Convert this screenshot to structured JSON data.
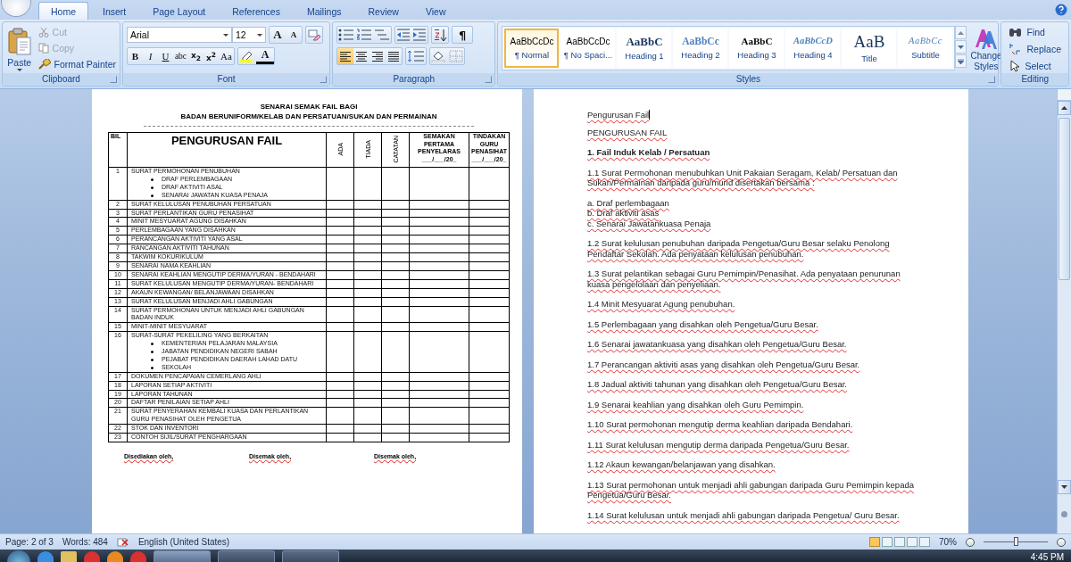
{
  "tabs": [
    {
      "label": "Home",
      "selected": true
    },
    {
      "label": "Insert",
      "selected": false
    },
    {
      "label": "Page Layout",
      "selected": false
    },
    {
      "label": "References",
      "selected": false
    },
    {
      "label": "Mailings",
      "selected": false
    },
    {
      "label": "Review",
      "selected": false
    },
    {
      "label": "View",
      "selected": false
    }
  ],
  "ribbon": {
    "clipboard": {
      "label": "Clipboard",
      "paste": "Paste",
      "items": [
        {
          "kind": "cut",
          "label": "Cut",
          "disabled": true
        },
        {
          "kind": "copy",
          "label": "Copy",
          "disabled": true
        },
        {
          "kind": "painter",
          "label": "Format Painter",
          "disabled": false
        }
      ]
    },
    "font": {
      "label": "Font",
      "font_name": "Arial",
      "font_size": "12",
      "grow": "A",
      "shrink": "A",
      "format_buttons": [
        {
          "kind": "bold",
          "label": "B"
        },
        {
          "kind": "italic",
          "label": "I"
        },
        {
          "kind": "underline",
          "label": "U"
        },
        {
          "kind": "strike",
          "label": "abc"
        },
        {
          "kind": "sub",
          "label": "x$_{2}$"
        },
        {
          "kind": "sup",
          "label": "x$^{2}$"
        },
        {
          "kind": "case",
          "label": "Aa"
        }
      ],
      "font_color": "A"
    },
    "paragraph": {
      "label": "Paragraph",
      "pilcrow": "¶",
      "alignment": [
        {
          "kind": "left",
          "selected": true
        },
        {
          "kind": "center",
          "selected": false
        },
        {
          "kind": "right",
          "selected": false
        },
        {
          "kind": "justify",
          "selected": false
        }
      ]
    },
    "styles": {
      "label": "Styles",
      "items": [
        {
          "kind": "normal",
          "preview": "AaBbCcDc",
          "name": "¶ Normal",
          "selected": true
        },
        {
          "kind": "normal",
          "preview": "AaBbCcDc",
          "name": "¶ No Spaci...",
          "selected": false
        },
        {
          "kind": "heading1",
          "preview": "AaBbC",
          "name": "Heading 1",
          "selected": false
        },
        {
          "kind": "heading2",
          "preview": "AaBbCc",
          "name": "Heading 2",
          "selected": false
        },
        {
          "kind": "heading3",
          "preview": "AaBbC",
          "name": "Heading 3",
          "selected": false
        },
        {
          "kind": "heading4",
          "preview": "AaBbCcD",
          "name": "Heading 4",
          "selected": false
        },
        {
          "kind": "title",
          "preview": "AaB",
          "name": "Title",
          "selected": false
        },
        {
          "kind": "subtitle",
          "preview": "AaBbCc",
          "name": "Subtitle",
          "selected": false
        }
      ],
      "change_styles": "Change Styles"
    },
    "editing": {
      "label": "Editing",
      "items": [
        {
          "kind": "find",
          "label": "Find"
        },
        {
          "kind": "replace",
          "label": "Replace"
        },
        {
          "kind": "select",
          "label": "Select"
        }
      ]
    }
  },
  "left_page": {
    "title_lines": [
      "SENARAI SEMAK FAIL BAGI",
      "BADAN BERUNIFORM/KELAB DAN PERSATUAN/SUKAN DAN PERMAINAN"
    ],
    "table": {
      "columns": [
        {
          "kind": "small",
          "label": "BIL"
        },
        {
          "kind": "big",
          "label": "PENGURUSAN FAIL"
        },
        {
          "kind": "vertical",
          "label": "ADA"
        },
        {
          "kind": "vertical",
          "label": "TIADA"
        },
        {
          "kind": "vertical",
          "label": "CATATAN"
        },
        {
          "kind": "small",
          "label": "SEMAKAN PERTAMA PENYELARAS ___/___/20_"
        },
        {
          "kind": "small",
          "label": "TINDAKAN GURU PENASIHAT ___/___/20_"
        }
      ],
      "rows": [
        {
          "no": "1",
          "text": "SURAT PERMOHONAN  PENUBUHAN",
          "bullets": [
            "DRAF PERLEMBAGAAN",
            "DRAF AKTIVITI ASAL",
            "SENARAI JAWATAN KUASA PENAJA"
          ]
        },
        {
          "no": "2",
          "text": "SURAT KELULUSAN  PENUBUHAN  PERSATUAN"
        },
        {
          "no": "3",
          "text": "SURAT PERLANTIKAN  GURU PENASIHAT"
        },
        {
          "no": "4",
          "text": "MINIT MESYUARAT AGUNG  DISAHKAN"
        },
        {
          "no": "5",
          "text": "PERLEMBAGAAN YANG DISAHKAN"
        },
        {
          "no": "6",
          "text": "PERANCANGAN AKTIVITI YANG ASAL"
        },
        {
          "no": "7",
          "text": "RANCANGAN AKTIVITI TAHUNAN"
        },
        {
          "no": "8",
          "text": "TAKWIM KOKURIKULUM"
        },
        {
          "no": "9",
          "text": "SENARAI NAMA KEAHLIAN"
        },
        {
          "no": "10",
          "text": "SENARAI KEAHLIAN MENGUTIP DERMA/YURAN  - BENDAHARI"
        },
        {
          "no": "11",
          "text": "SURAT KELULUSAN  MENGUTIP DERMA/YURAN- BENDAHARI"
        },
        {
          "no": "12",
          "text": "AKAUN KEWANGAN/ BELANJAWAAN  DISAHKAN"
        },
        {
          "no": "13",
          "text": "SURAT KELULUSAN  MENJADI AHLI GABUNGAN"
        },
        {
          "no": "14",
          "text": "SURAT PERMOHONAN  UNTUK  MENJADI AHLI GABUNGAN  BADAN  INDUK"
        },
        {
          "no": "15",
          "text": "MINIT-MINIT  MESYUARAT"
        },
        {
          "no": "16",
          "text": "SURAT-SURAT  PEKELILING  YANG  BERKAITAN",
          "bullets": [
            "KEMENTERIAN  PELAJARAN  MALAYSIA",
            "JABATAN  PENDIDIKAN  NEGERI  SABAH",
            "PEJABAT  PENDIDIKAN  DAERAH  LAHAD DATU",
            "SEKOLAH"
          ]
        },
        {
          "no": "17",
          "text": "DOKUMEN  PENCAPAIAN  CEMERLANG  AHLI"
        },
        {
          "no": "18",
          "text": "LAPORAN  SETIAP AKTIVITI"
        },
        {
          "no": "19",
          "text": "LAPORAN  TAHUNAN"
        },
        {
          "no": "20",
          "text": "DAFTAR PENILAIAN  SETIAP AHLI"
        },
        {
          "no": "21",
          "text": "SURAT PENYERAHAN  KEMBALI  KUASA DAN PERLANTIKAN  GURU  PENASIHAT OLEH  PENGETUA"
        },
        {
          "no": "22",
          "text": "STOK DAN INVENTORI"
        },
        {
          "no": "23",
          "text": "CONTOH  SIJIL/SURAT  PENGHARGAAN"
        }
      ]
    },
    "signatures": [
      "Disediakan oleh,",
      "Disemak oleh,",
      "Disemak oleh,"
    ]
  },
  "right_page": {
    "spelling_marked": true,
    "paragraphs": [
      {
        "kind": "plain",
        "text": "Pengurusan Fail",
        "caret": true
      },
      {
        "kind": "plain",
        "text": "PENGURUSAN  FAIL"
      },
      {
        "kind": "heading",
        "text": "1. Fail  Induk Kelab / Persatuan"
      },
      {
        "kind": "plain",
        "text": "1.1 Surat Permohonan menubuhkan Unit Pakaian Seragam, Kelab/  Persatuan dan Sukan/Permainan daripada guru/murid disertakan bersama :"
      },
      {
        "kind": "lines",
        "lines": [
          "a. Draf  perlembagaan",
          "b. Draf  aktiviti asas",
          "c. Senarai Jawatankuasa Penaja"
        ]
      },
      {
        "kind": "plain",
        "text": "1.2 Surat kelulusan penubuhan daripada Pengetua/Guru Besar selaku Penolong Pendaftar Sekolah. Ada penyataan kelulusan penubuhan."
      },
      {
        "kind": "plain",
        "text": "1.3 Surat pelantikan sebagai Guru Pemimpin/Penasihat. Ada penyataan penurunan kuasa pengelolaan dan penyeliaan."
      },
      {
        "kind": "plain",
        "text": "1.4 Minit Mesyuarat Agung penubuhan."
      },
      {
        "kind": "plain",
        "text": "1.5 Perlembagaan yang disahkan oleh Pengetua/Guru Besar."
      },
      {
        "kind": "plain",
        "text": "1.6 Senarai jawatankuasa yang disahkan oleh Pengetua/Guru Besar."
      },
      {
        "kind": "plain",
        "text": "1.7 Perancangan aktiviti asas yang disahkan oleh Pengetua/Guru Besar."
      },
      {
        "kind": "plain",
        "text": "1.8 Jadual aktiviti tahunan yang disahkan oleh Pengetua/Guru Besar."
      },
      {
        "kind": "plain",
        "text": "1.9 Senarai keahlian yang disahkan oleh Guru Pemimpin."
      },
      {
        "kind": "plain",
        "text": "1.10 Surat  permohonan mengutip derma keahlian daripada Bendahari."
      },
      {
        "kind": "plain",
        "text": "1.11 Surat  kelulusan mengutip derma daripada Pengetua/Guru Besar."
      },
      {
        "kind": "plain",
        "text": "1.12 Akaun  kewangan/belanjawan yang disahkan."
      },
      {
        "kind": "plain",
        "text": "1.13 Surat  permohonan untuk menjadi ahli gabungan daripada Guru Pemimpin kepada Pengetua/Guru Besar."
      },
      {
        "kind": "plain",
        "text": "1.14 Surat  kelulusan untuk menjadi ahli gabungan daripada Pengetua/ Guru Besar."
      }
    ]
  },
  "status_bar": {
    "page": "Page: 2 of 3",
    "words": "Words: 484",
    "language": "English (United States)",
    "zoom": "70%",
    "zoom_slider": {
      "level": 0.5
    }
  },
  "taskbar": {
    "time": "4:45 PM"
  }
}
